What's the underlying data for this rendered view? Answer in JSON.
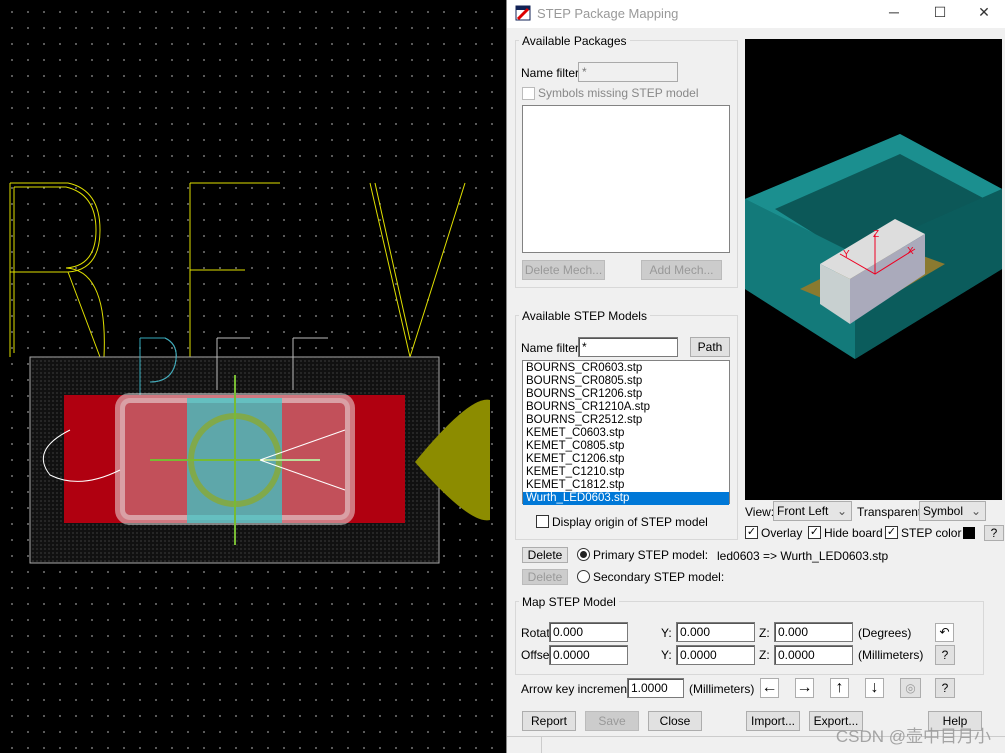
{
  "window": {
    "title": "STEP Package Mapping",
    "minimize_icon": "minimize-icon",
    "maximize_icon": "maximize-icon",
    "close_icon": "close-icon"
  },
  "packages": {
    "group_label": "Available Packages",
    "name_filter_label": "Name filter:",
    "name_filter_value": "*",
    "symbols_missing_label": "Symbols missing STEP model",
    "symbols_missing_checked": false,
    "delete_mech": "Delete Mech...",
    "add_mech": "Add Mech...",
    "items": []
  },
  "models": {
    "group_label": "Available STEP Models",
    "name_filter_label": "Name filter:",
    "name_filter_value": "*",
    "path_button": "Path",
    "items": [
      "BOURNS_CR0603.stp",
      "BOURNS_CR0805.stp",
      "BOURNS_CR1206.stp",
      "BOURNS_CR1210A.stp",
      "BOURNS_CR2512.stp",
      "KEMET_C0603.stp",
      "KEMET_C0805.stp",
      "KEMET_C1206.stp",
      "KEMET_C1210.stp",
      "KEMET_C1812.stp",
      "Wurth_LED0603.stp"
    ],
    "selected": "Wurth_LED0603.stp",
    "display_origin_label": "Display origin of STEP model",
    "display_origin_checked": false
  },
  "view": {
    "view_label": "View:",
    "view_value": "Front Left",
    "transparent_label": "Transparent:",
    "transparent_value": "Symbol",
    "overlay_label": "Overlay",
    "overlay_checked": true,
    "hide_board_label": "Hide board",
    "hide_board_checked": true,
    "step_color_label": "STEP color",
    "step_color": "#000000",
    "help": "?"
  },
  "primary": {
    "delete": "Delete",
    "label": "Primary STEP model:",
    "value": "led0603 => Wurth_LED0603.stp",
    "selected": true
  },
  "secondary": {
    "delete": "Delete",
    "label": "Secondary STEP model:",
    "value": "",
    "selected": false
  },
  "map": {
    "group_label": "Map STEP Model",
    "rotation_label": "Rotation X:",
    "y_label": "Y:",
    "z_label": "Z:",
    "rot_x": "0.000",
    "rot_y": "0.000",
    "rot_z": "0.000",
    "degrees": "(Degrees)",
    "offset_label": "Offset X:",
    "off_x": "0.0000",
    "off_y": "0.0000",
    "off_z": "0.0000",
    "millimeters": "(Millimeters)",
    "help": "?"
  },
  "arrow": {
    "label": "Arrow key increment:",
    "value": "1.0000",
    "unit": "(Millimeters)",
    "help": "?"
  },
  "buttons": {
    "report": "Report",
    "save": "Save",
    "close": "Close",
    "import": "Import...",
    "export": "Export...",
    "help": "Help"
  },
  "watermark": "CSDN @壶中目月小",
  "colors": {
    "selection": "#0078d7",
    "pad_red": "#b00010",
    "silk_yellow": "#ffff00",
    "teal": "#1a7a7a",
    "olive": "#8c8c00"
  }
}
